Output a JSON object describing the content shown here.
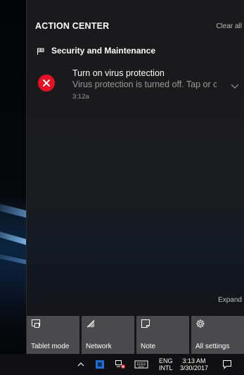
{
  "action_center": {
    "title": "ACTION CENTER",
    "clear_all": "Clear all",
    "expand": "Expand"
  },
  "notification_group": {
    "title": "Security and Maintenance",
    "icon": "security-flag-icon"
  },
  "notification": {
    "title": "Turn on virus protection",
    "body": "Virus protection is turned off. Tap or c",
    "time": "3:12a",
    "icon": "error-x-icon",
    "icon_color": "#e81123"
  },
  "quick_actions": [
    {
      "label": "Tablet mode",
      "icon": "tablet-mode-icon"
    },
    {
      "label": "Network",
      "icon": "network-icon"
    },
    {
      "label": "Note",
      "icon": "note-icon"
    },
    {
      "label": "All settings",
      "icon": "settings-gear-icon"
    }
  ],
  "taskbar": {
    "language_line1": "ENG",
    "language_line2": "INTL",
    "time": "3:13 AM",
    "date": "3/30/2017"
  },
  "colors": {
    "panel_bg": "#1a1a1c",
    "tile_bg": "#4a4a4d",
    "taskbar_bg": "#101012"
  }
}
